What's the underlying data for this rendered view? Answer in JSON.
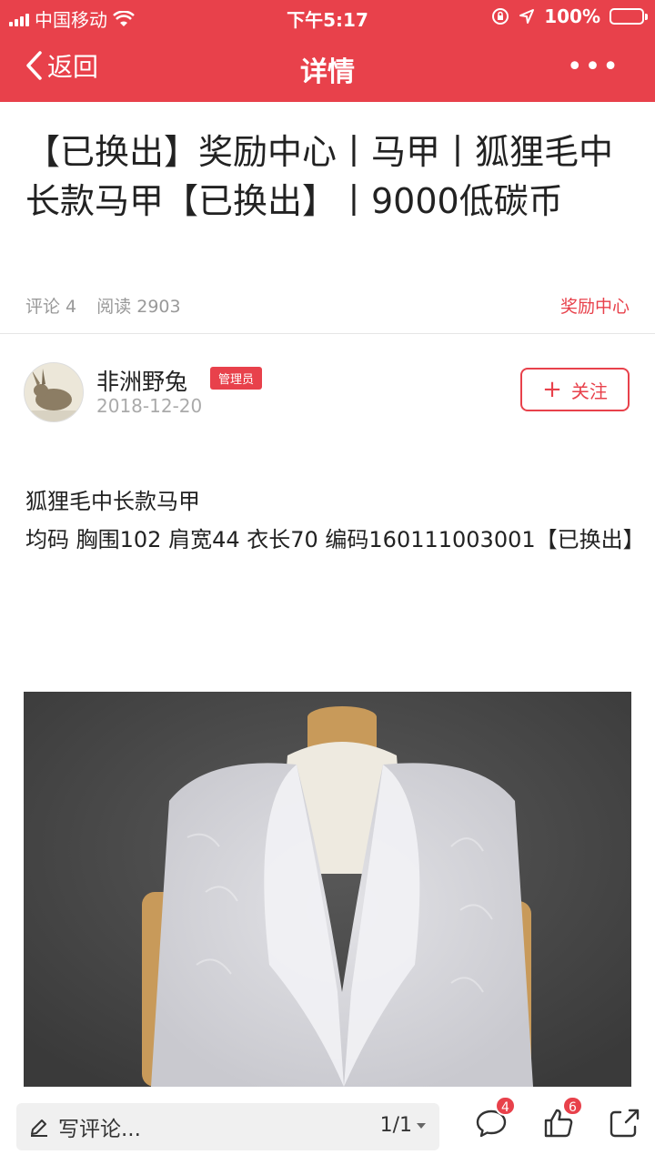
{
  "status_bar": {
    "carrier": "中国移动",
    "time": "下午5:17",
    "battery": "100%"
  },
  "nav": {
    "back_label": "返回",
    "title": "详情",
    "more_label": "•••"
  },
  "article": {
    "title": "【已换出】奖励中心丨马甲丨狐狸毛中长款马甲【已换出】丨9000低碳币",
    "comments": "评论 4",
    "reads": "阅读 2903",
    "category": "奖励中心"
  },
  "author": {
    "name": "非洲野兔",
    "badge": "管理员",
    "date": "2018-12-20",
    "follow_label": "关注",
    "follow_icon": "+"
  },
  "content": {
    "line1": "狐狸毛中长款马甲",
    "line2": "均码  胸围102  肩宽44  衣长70  编码160111003001【已换出】"
  },
  "bottom": {
    "comment_placeholder": "写评论...",
    "pager": "1/1",
    "comment_count": "4",
    "like_count": "6"
  },
  "icons": {
    "back": "chevron-left-icon",
    "more": "more-dots-icon",
    "pen": "pen-icon",
    "comment": "comment-bubble-icon",
    "like": "thumbs-up-icon",
    "share": "share-icon"
  },
  "colors": {
    "accent": "#e8414b",
    "meta_text": "#999999",
    "photo_bg": "#4a4a4a"
  }
}
